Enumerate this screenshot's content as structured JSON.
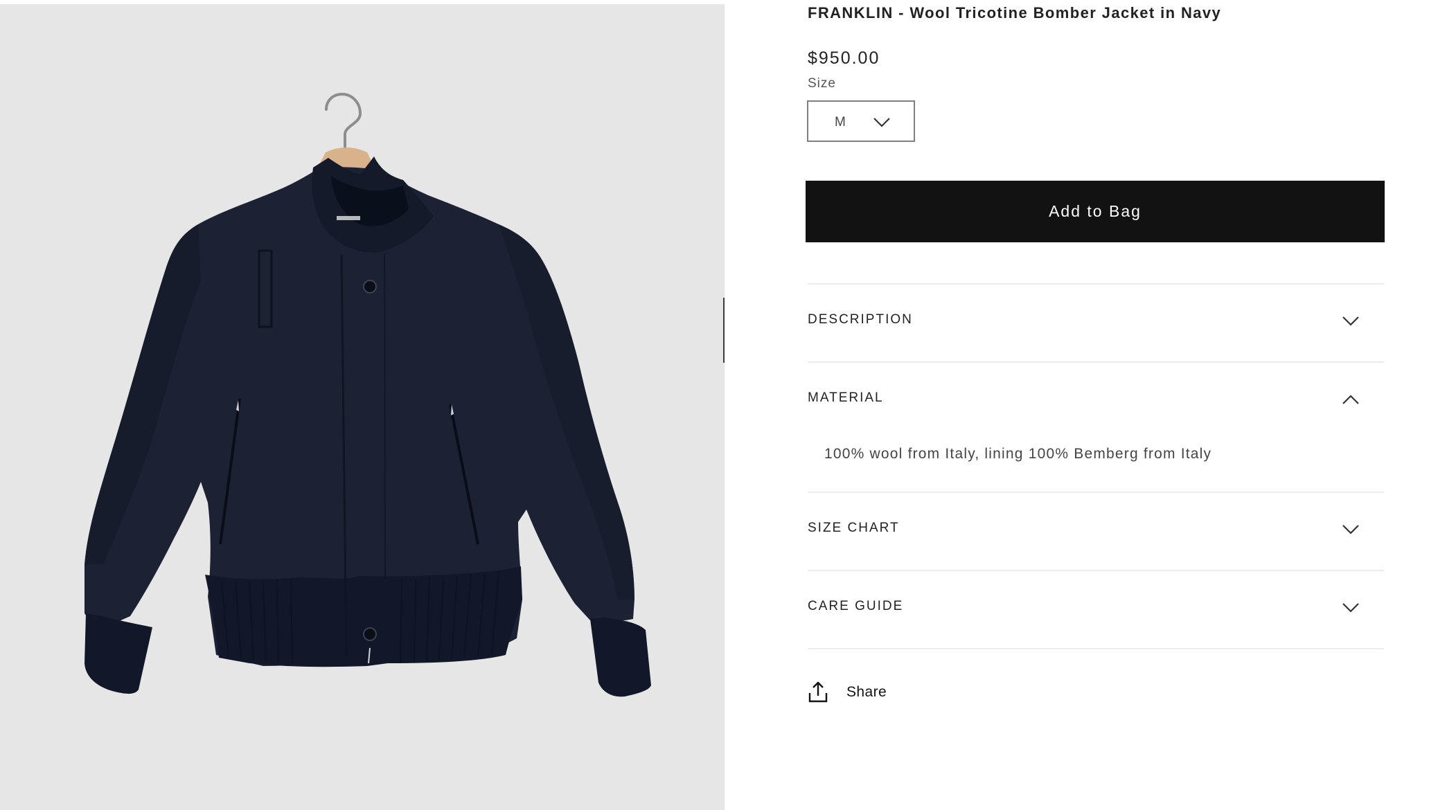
{
  "product": {
    "title": "FRANKLIN - Wool Tricotine Bomber Jacket in Navy",
    "price": "$950.00",
    "image_alt": "Navy wool bomber jacket on a wooden hanger"
  },
  "size": {
    "label": "Size",
    "selected": "M"
  },
  "actions": {
    "add_to_bag": "Add to Bag",
    "share": "Share"
  },
  "accordion": {
    "description": {
      "title": "DESCRIPTION",
      "expanded": false
    },
    "material": {
      "title": "MATERIAL",
      "expanded": true,
      "body": "100% wool from Italy, lining 100% Bemberg from Italy"
    },
    "size_chart": {
      "title": "SIZE CHART",
      "expanded": false
    },
    "care_guide": {
      "title": "CARE GUIDE",
      "expanded": false
    }
  },
  "icons": {
    "size_select": "chevron-down-icon",
    "share": "share-icon"
  },
  "colors": {
    "button_bg": "#121212",
    "button_text": "#ffffff",
    "gallery_bg": "#e6e6e6",
    "jacket": "#1c2233"
  }
}
